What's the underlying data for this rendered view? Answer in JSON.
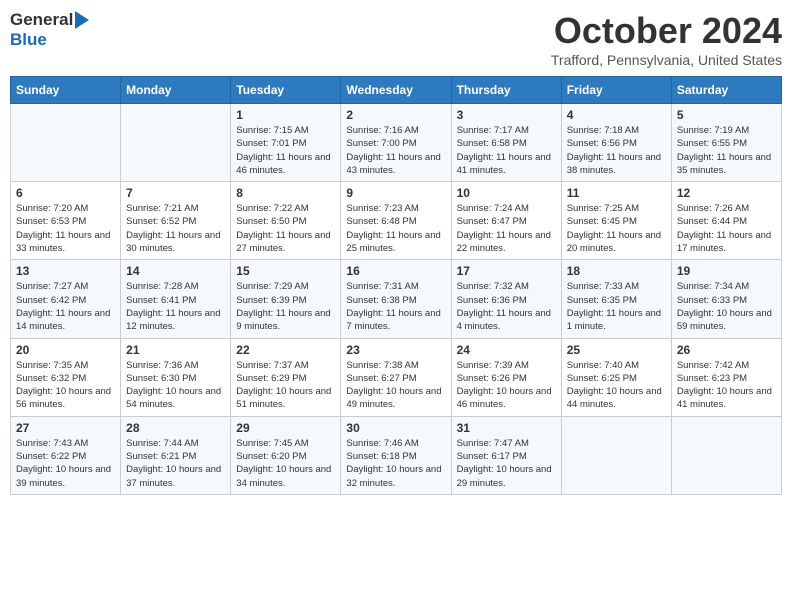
{
  "header": {
    "logo_general": "General",
    "logo_blue": "Blue",
    "month": "October 2024",
    "location": "Trafford, Pennsylvania, United States"
  },
  "days_of_week": [
    "Sunday",
    "Monday",
    "Tuesday",
    "Wednesday",
    "Thursday",
    "Friday",
    "Saturday"
  ],
  "weeks": [
    [
      {
        "day": "",
        "sunrise": "",
        "sunset": "",
        "daylight": ""
      },
      {
        "day": "",
        "sunrise": "",
        "sunset": "",
        "daylight": ""
      },
      {
        "day": "1",
        "sunrise": "Sunrise: 7:15 AM",
        "sunset": "Sunset: 7:01 PM",
        "daylight": "Daylight: 11 hours and 46 minutes."
      },
      {
        "day": "2",
        "sunrise": "Sunrise: 7:16 AM",
        "sunset": "Sunset: 7:00 PM",
        "daylight": "Daylight: 11 hours and 43 minutes."
      },
      {
        "day": "3",
        "sunrise": "Sunrise: 7:17 AM",
        "sunset": "Sunset: 6:58 PM",
        "daylight": "Daylight: 11 hours and 41 minutes."
      },
      {
        "day": "4",
        "sunrise": "Sunrise: 7:18 AM",
        "sunset": "Sunset: 6:56 PM",
        "daylight": "Daylight: 11 hours and 38 minutes."
      },
      {
        "day": "5",
        "sunrise": "Sunrise: 7:19 AM",
        "sunset": "Sunset: 6:55 PM",
        "daylight": "Daylight: 11 hours and 35 minutes."
      }
    ],
    [
      {
        "day": "6",
        "sunrise": "Sunrise: 7:20 AM",
        "sunset": "Sunset: 6:53 PM",
        "daylight": "Daylight: 11 hours and 33 minutes."
      },
      {
        "day": "7",
        "sunrise": "Sunrise: 7:21 AM",
        "sunset": "Sunset: 6:52 PM",
        "daylight": "Daylight: 11 hours and 30 minutes."
      },
      {
        "day": "8",
        "sunrise": "Sunrise: 7:22 AM",
        "sunset": "Sunset: 6:50 PM",
        "daylight": "Daylight: 11 hours and 27 minutes."
      },
      {
        "day": "9",
        "sunrise": "Sunrise: 7:23 AM",
        "sunset": "Sunset: 6:48 PM",
        "daylight": "Daylight: 11 hours and 25 minutes."
      },
      {
        "day": "10",
        "sunrise": "Sunrise: 7:24 AM",
        "sunset": "Sunset: 6:47 PM",
        "daylight": "Daylight: 11 hours and 22 minutes."
      },
      {
        "day": "11",
        "sunrise": "Sunrise: 7:25 AM",
        "sunset": "Sunset: 6:45 PM",
        "daylight": "Daylight: 11 hours and 20 minutes."
      },
      {
        "day": "12",
        "sunrise": "Sunrise: 7:26 AM",
        "sunset": "Sunset: 6:44 PM",
        "daylight": "Daylight: 11 hours and 17 minutes."
      }
    ],
    [
      {
        "day": "13",
        "sunrise": "Sunrise: 7:27 AM",
        "sunset": "Sunset: 6:42 PM",
        "daylight": "Daylight: 11 hours and 14 minutes."
      },
      {
        "day": "14",
        "sunrise": "Sunrise: 7:28 AM",
        "sunset": "Sunset: 6:41 PM",
        "daylight": "Daylight: 11 hours and 12 minutes."
      },
      {
        "day": "15",
        "sunrise": "Sunrise: 7:29 AM",
        "sunset": "Sunset: 6:39 PM",
        "daylight": "Daylight: 11 hours and 9 minutes."
      },
      {
        "day": "16",
        "sunrise": "Sunrise: 7:31 AM",
        "sunset": "Sunset: 6:38 PM",
        "daylight": "Daylight: 11 hours and 7 minutes."
      },
      {
        "day": "17",
        "sunrise": "Sunrise: 7:32 AM",
        "sunset": "Sunset: 6:36 PM",
        "daylight": "Daylight: 11 hours and 4 minutes."
      },
      {
        "day": "18",
        "sunrise": "Sunrise: 7:33 AM",
        "sunset": "Sunset: 6:35 PM",
        "daylight": "Daylight: 11 hours and 1 minute."
      },
      {
        "day": "19",
        "sunrise": "Sunrise: 7:34 AM",
        "sunset": "Sunset: 6:33 PM",
        "daylight": "Daylight: 10 hours and 59 minutes."
      }
    ],
    [
      {
        "day": "20",
        "sunrise": "Sunrise: 7:35 AM",
        "sunset": "Sunset: 6:32 PM",
        "daylight": "Daylight: 10 hours and 56 minutes."
      },
      {
        "day": "21",
        "sunrise": "Sunrise: 7:36 AM",
        "sunset": "Sunset: 6:30 PM",
        "daylight": "Daylight: 10 hours and 54 minutes."
      },
      {
        "day": "22",
        "sunrise": "Sunrise: 7:37 AM",
        "sunset": "Sunset: 6:29 PM",
        "daylight": "Daylight: 10 hours and 51 minutes."
      },
      {
        "day": "23",
        "sunrise": "Sunrise: 7:38 AM",
        "sunset": "Sunset: 6:27 PM",
        "daylight": "Daylight: 10 hours and 49 minutes."
      },
      {
        "day": "24",
        "sunrise": "Sunrise: 7:39 AM",
        "sunset": "Sunset: 6:26 PM",
        "daylight": "Daylight: 10 hours and 46 minutes."
      },
      {
        "day": "25",
        "sunrise": "Sunrise: 7:40 AM",
        "sunset": "Sunset: 6:25 PM",
        "daylight": "Daylight: 10 hours and 44 minutes."
      },
      {
        "day": "26",
        "sunrise": "Sunrise: 7:42 AM",
        "sunset": "Sunset: 6:23 PM",
        "daylight": "Daylight: 10 hours and 41 minutes."
      }
    ],
    [
      {
        "day": "27",
        "sunrise": "Sunrise: 7:43 AM",
        "sunset": "Sunset: 6:22 PM",
        "daylight": "Daylight: 10 hours and 39 minutes."
      },
      {
        "day": "28",
        "sunrise": "Sunrise: 7:44 AM",
        "sunset": "Sunset: 6:21 PM",
        "daylight": "Daylight: 10 hours and 37 minutes."
      },
      {
        "day": "29",
        "sunrise": "Sunrise: 7:45 AM",
        "sunset": "Sunset: 6:20 PM",
        "daylight": "Daylight: 10 hours and 34 minutes."
      },
      {
        "day": "30",
        "sunrise": "Sunrise: 7:46 AM",
        "sunset": "Sunset: 6:18 PM",
        "daylight": "Daylight: 10 hours and 32 minutes."
      },
      {
        "day": "31",
        "sunrise": "Sunrise: 7:47 AM",
        "sunset": "Sunset: 6:17 PM",
        "daylight": "Daylight: 10 hours and 29 minutes."
      },
      {
        "day": "",
        "sunrise": "",
        "sunset": "",
        "daylight": ""
      },
      {
        "day": "",
        "sunrise": "",
        "sunset": "",
        "daylight": ""
      }
    ]
  ]
}
